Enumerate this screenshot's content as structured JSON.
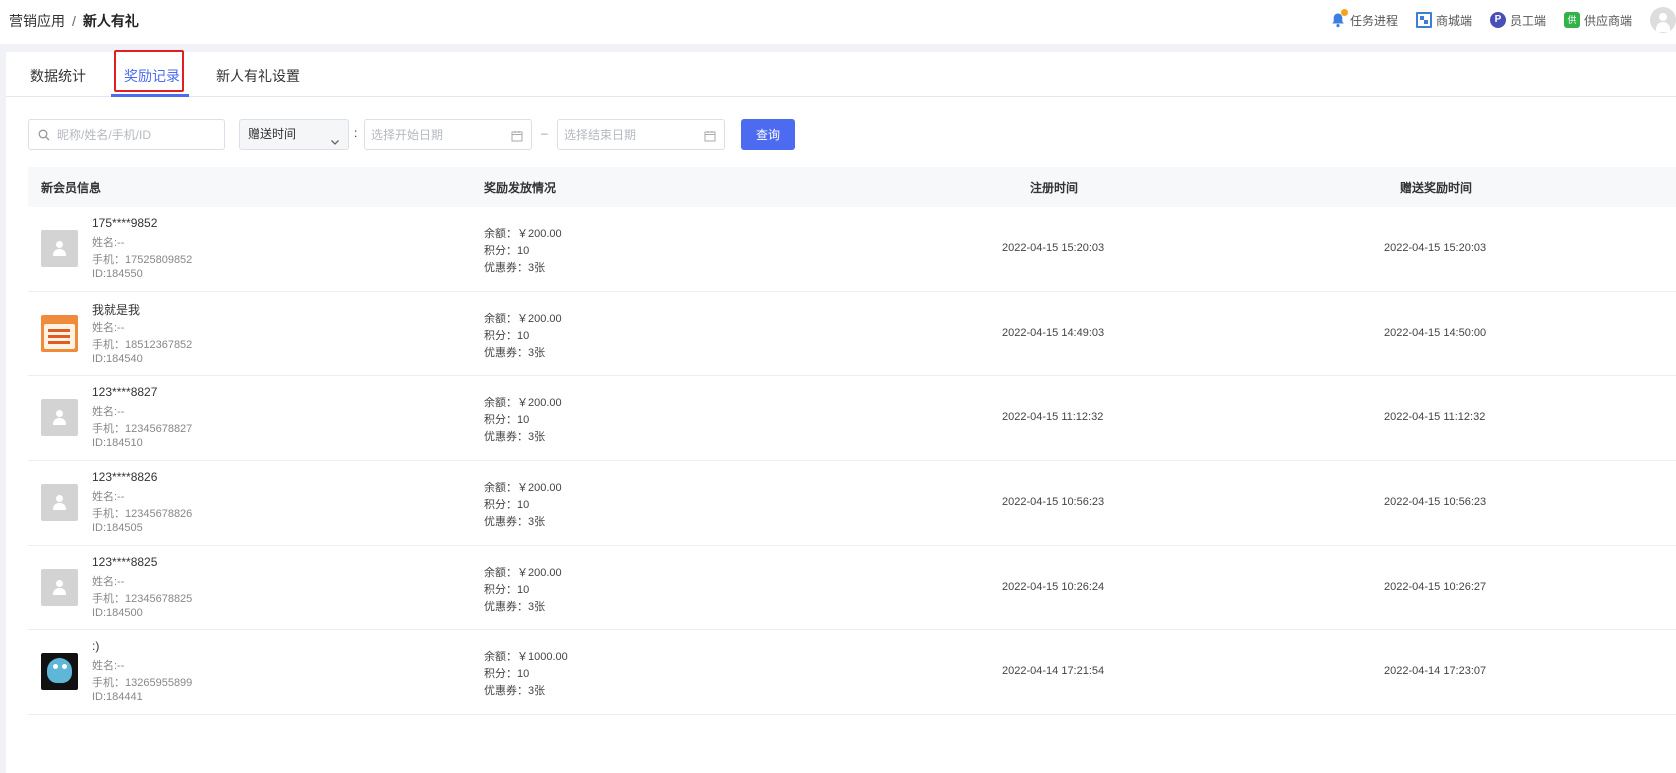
{
  "breadcrumb": {
    "parent": "营销应用",
    "separator": "/",
    "current": "新人有礼"
  },
  "toplinks": [
    {
      "label": "任务进程",
      "icon": "bell-icon"
    },
    {
      "label": "商城端",
      "icon": "qrcode-icon"
    },
    {
      "label": "员工端",
      "icon": "staff-icon"
    },
    {
      "label": "供应商端",
      "icon": "supplier-icon"
    }
  ],
  "tabs": [
    {
      "label": "数据统计"
    },
    {
      "label": "奖励记录",
      "active": true
    },
    {
      "label": "新人有礼设置"
    }
  ],
  "filters": {
    "search_placeholder": "昵称/姓名/手机/ID",
    "time_type": "赠送时间",
    "colon": ":",
    "start_placeholder": "选择开始日期",
    "range_sep": "–",
    "end_placeholder": "选择结束日期",
    "query_label": "查询"
  },
  "table": {
    "headers": [
      "新会员信息",
      "奖励发放情况",
      "注册时间",
      "赠送奖励时间"
    ],
    "rows": [
      {
        "avatar": "default-avatar",
        "nickname": "175****9852",
        "name": "姓名:--",
        "phone": "手机：17525809852",
        "id": "ID:184550",
        "balance": "余额：￥200.00",
        "points": "积分：10",
        "coupons": "优惠券：3张",
        "registered": "2022-04-15 15:20:03",
        "rewarded": "2022-04-15 15:20:03"
      },
      {
        "avatar": "poster-avatar",
        "nickname": "我就是我",
        "name": "姓名:--",
        "phone": "手机：18512367852",
        "id": "ID:184540",
        "balance": "余额：￥200.00",
        "points": "积分：10",
        "coupons": "优惠券：3张",
        "registered": "2022-04-15 14:49:03",
        "rewarded": "2022-04-15 14:50:00"
      },
      {
        "avatar": "default-avatar",
        "nickname": "123****8827",
        "name": "姓名:--",
        "phone": "手机：12345678827",
        "id": "ID:184510",
        "balance": "余额：￥200.00",
        "points": "积分：10",
        "coupons": "优惠券：3张",
        "registered": "2022-04-15 11:12:32",
        "rewarded": "2022-04-15 11:12:32"
      },
      {
        "avatar": "default-avatar",
        "nickname": "123****8826",
        "name": "姓名:--",
        "phone": "手机：12345678826",
        "id": "ID:184505",
        "balance": "余额：￥200.00",
        "points": "积分：10",
        "coupons": "优惠券：3张",
        "registered": "2022-04-15 10:56:23",
        "rewarded": "2022-04-15 10:56:23"
      },
      {
        "avatar": "default-avatar",
        "nickname": "123****8825",
        "name": "姓名:--",
        "phone": "手机：12345678825",
        "id": "ID:184500",
        "balance": "余额：￥200.00",
        "points": "积分：10",
        "coupons": "优惠券：3张",
        "registered": "2022-04-15 10:26:24",
        "rewarded": "2022-04-15 10:26:27"
      },
      {
        "avatar": "gopher-avatar",
        "nickname": ":)",
        "name": "姓名:--",
        "phone": "手机：13265955899",
        "id": "ID:184441",
        "balance": "余额：￥1000.00",
        "points": "积分：10",
        "coupons": "优惠券：3张",
        "registered": "2022-04-14 17:21:54",
        "rewarded": "2022-04-14 17:23:07"
      }
    ]
  },
  "colors": {
    "accent": "#4c6bf0",
    "highlight": "#e02020",
    "notify_dot": "#f7a21b"
  }
}
